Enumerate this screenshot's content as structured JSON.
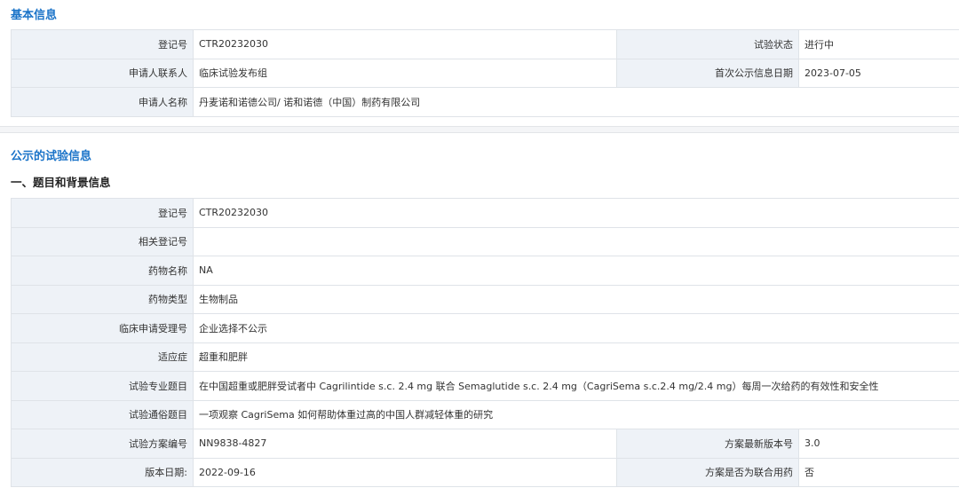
{
  "basic": {
    "title": "基本信息",
    "reg_no_label": "登记号",
    "reg_no": "CTR20232030",
    "status_label": "试验状态",
    "status": "进行中",
    "contact_label": "申请人联系人",
    "contact": "临床试验发布组",
    "first_date_label": "首次公示信息日期",
    "first_date": "2023-07-05",
    "applicant_label": "申请人名称",
    "applicant": "丹麦诺和诺德公司/ 诺和诺德（中国）制药有限公司"
  },
  "public": {
    "title": "公示的试验信息",
    "subtitle": "一、题目和背景信息",
    "rows": [
      {
        "label": "登记号",
        "value": "CTR20232030"
      },
      {
        "label": "相关登记号",
        "value": ""
      },
      {
        "label": "药物名称",
        "value": "NA"
      },
      {
        "label": "药物类型",
        "value": "生物制品"
      },
      {
        "label": "临床申请受理号",
        "value": "企业选择不公示"
      },
      {
        "label": "适应症",
        "value": "超重和肥胖"
      },
      {
        "label": "试验专业题目",
        "value": "在中国超重或肥胖受试者中 Cagrilintide s.c. 2.4 mg 联合 Semaglutide s.c. 2.4 mg（CagriSema s.c.2.4 mg/2.4 mg）每周一次给药的有效性和安全性"
      },
      {
        "label": "试验通俗题目",
        "value": "一项观察 CagriSema 如何帮助体重过高的中国人群减轻体重的研究"
      }
    ],
    "protocol_label": "试验方案编号",
    "protocol": "NN9838-4827",
    "version_label": "方案最新版本号",
    "version": "3.0",
    "version_date_label": "版本日期:",
    "version_date": "2022-09-16",
    "combo_label": "方案是否为联合用药",
    "combo": "否"
  }
}
